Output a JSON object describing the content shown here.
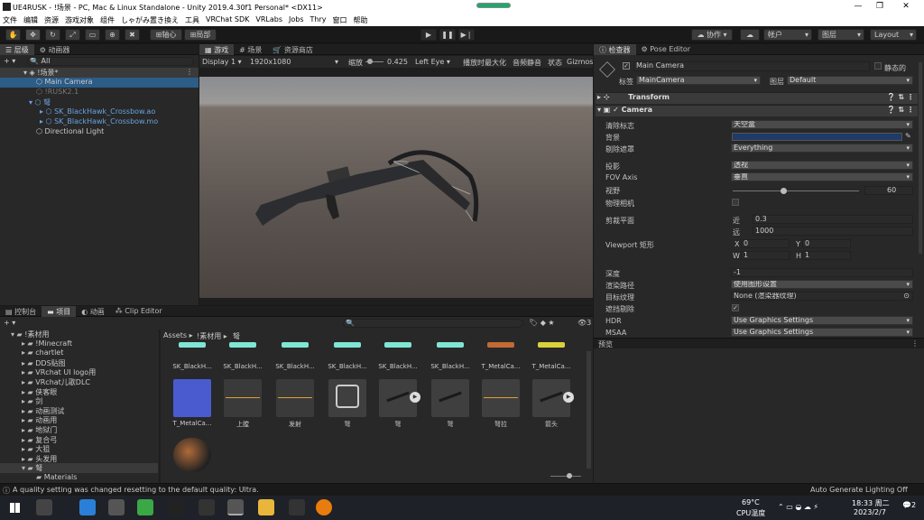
{
  "window": {
    "title": "UE4RUSK - !场景 - PC, Mac & Linux Standalone - Unity 2019.4.30f1 Personal* <DX11>"
  },
  "menu": [
    "文件",
    "编辑",
    "资源",
    "游戏对象",
    "组件",
    "しゃがみ置き換え",
    "工具",
    "VRChat SDK",
    "VRLabs",
    "Jobs",
    "Thry",
    "窗口",
    "帮助"
  ],
  "toolbar": {
    "pivot": "轴心",
    "local": "局部",
    "collab": "协作",
    "account": "帐户",
    "layers": "图层",
    "layout": "Layout"
  },
  "hierarchy": {
    "tab": "层级",
    "tab2": "动画器",
    "search": "All",
    "scene": "!场景*",
    "items": [
      "Main Camera",
      "!RUSK2.1",
      "弩",
      "SK_BlackHawk_Crossbow.ao",
      "SK_BlackHawk_Crossbow.mo",
      "Directional Light"
    ]
  },
  "game": {
    "tabs": [
      "游戏",
      "场景",
      "资源商店"
    ],
    "display": "Display 1",
    "resolution": "1920x1080",
    "scale_label": "缩放",
    "scale_value": "0.425",
    "eye": "Left Eye",
    "maximize": "播放时最大化",
    "mute": "音频静音",
    "stats": "状态",
    "gizmos": "Gizmos"
  },
  "project": {
    "tabs": [
      "控制台",
      "项目",
      "动画",
      "Clip Editor"
    ],
    "breadcrumb": [
      "Assets",
      "!素材用",
      "弩"
    ],
    "count": "3",
    "folders": [
      "!素材用",
      "!Minecraft",
      "chartlet",
      "DDS贴图",
      "VRchat UI logo用",
      "VRchat儿歌DLC",
      "侠客眼",
      "剑",
      "动画测试",
      "动画用",
      "地狱门",
      "复合弓",
      "大狙",
      "头发用",
      "弩",
      "Materials"
    ],
    "row1": [
      "SK_BlackH...",
      "SK_BlackH...",
      "SK_BlackH...",
      "SK_BlackH...",
      "SK_BlackH...",
      "SK_BlackH...",
      "T_MetalCa...",
      "T_MetalCa..."
    ],
    "row2": [
      "T_MetalCa...",
      "上膛",
      "发射",
      "弩",
      "弩",
      "弩",
      "弩拉",
      "箭头"
    ]
  },
  "inspector": {
    "tabs": [
      "检查器",
      "Pose Editor"
    ],
    "object_name": "Main Camera",
    "static": "静态的",
    "tag_label": "标签",
    "tag": "MainCamera",
    "layer_label": "图层",
    "layer": "Default",
    "transform": "Transform",
    "camera": "Camera",
    "props": {
      "clear_flags": [
        "清除标志",
        "天空盒"
      ],
      "background": [
        "背景",
        ""
      ],
      "culling": [
        "剔除遮罩",
        "Everything"
      ],
      "projection": [
        "投影",
        "透视"
      ],
      "fov_axis": [
        "FOV Axis",
        "垂直"
      ],
      "fov": [
        "视野",
        "60"
      ],
      "physical": [
        "物理相机",
        ""
      ],
      "clip": [
        "剪裁平面",
        ""
      ],
      "near": [
        "近",
        "0.3"
      ],
      "far": [
        "远",
        "1000"
      ],
      "viewport": [
        "Viewport 矩形",
        ""
      ],
      "vx": [
        "X",
        "0"
      ],
      "vy": [
        "Y",
        "0"
      ],
      "vw": [
        "W",
        "1"
      ],
      "vh": [
        "H",
        "1"
      ],
      "depth": [
        "深度",
        "-1"
      ],
      "render_path": [
        "渲染路径",
        "使用图形设置"
      ],
      "target_tex": [
        "目标纹理",
        "None (渲染器纹理)"
      ],
      "occlusion": [
        "遮挡剔除",
        ""
      ],
      "hdr": [
        "HDR",
        "Use Graphics Settings"
      ],
      "msaa": [
        "MSAA",
        "Use Graphics Settings"
      ]
    },
    "preview": "预览",
    "fov_fraction": 0.38
  },
  "status": {
    "message": "A quality setting was changed resetting to the default quality: Ultra.",
    "lighting": "Auto Generate Lighting Off"
  },
  "taskbar": {
    "temp": "69°C",
    "temp_label": "CPU温度",
    "time": "18:33 周二",
    "date": "2023/2/7",
    "notif": "2"
  },
  "colors": {
    "accent": "#2c5d87",
    "bg_color": "#1f3b66"
  }
}
